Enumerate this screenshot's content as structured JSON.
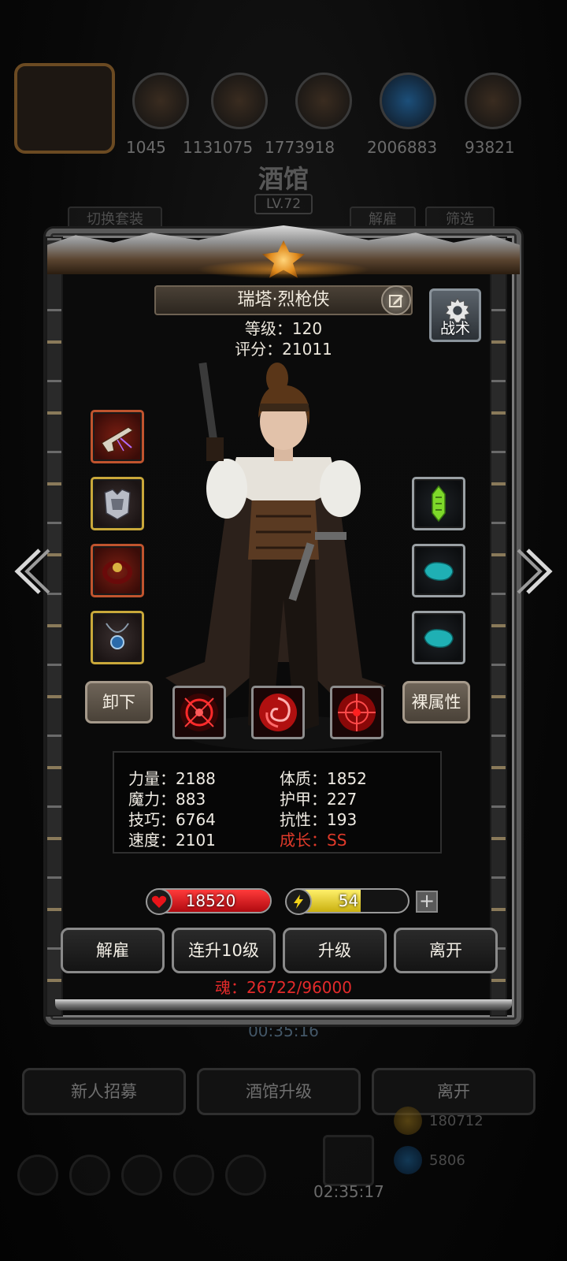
{
  "background": {
    "resource_numbers": [
      "1045",
      "1131075",
      "1773918",
      "2006883",
      "93821"
    ],
    "title": "酒馆",
    "level": "LV.72",
    "switch_outfit": "切换套装",
    "dismiss": "解雇",
    "filter": "筛选",
    "timer_mid": "00:35:16",
    "buttons": [
      "新人招募",
      "酒馆升级",
      "离开"
    ],
    "timer_bottom": "02:35:17",
    "gold": "180712",
    "gems": "5806"
  },
  "hero": {
    "name": "瑞塔·烈枪侠",
    "level_label": "等级：120",
    "score_label": "评分：21011",
    "tactics_label": "战术"
  },
  "actions": {
    "unequip": "卸下",
    "naked_attr": "裸属性"
  },
  "stats": [
    {
      "label": "力量：2188"
    },
    {
      "label": "体质：1852"
    },
    {
      "label": "魔力：883"
    },
    {
      "label": "护甲：227"
    },
    {
      "label": "技巧：6764"
    },
    {
      "label": "抗性：193"
    },
    {
      "label": "速度：2101"
    },
    {
      "label": "成长：SS"
    }
  ],
  "hp": {
    "value": "18520",
    "fill": 1.0
  },
  "energy": {
    "value": "54",
    "fill": 0.6
  },
  "panel_buttons": {
    "dismiss": "解雇",
    "level_up_10": "连升10级",
    "level_up": "升级",
    "leave": "离开"
  },
  "soul": "魂：26722/96000",
  "colors": {
    "hp": "#d8141a",
    "energy": "#e8d21a",
    "growth": "#e03a2a",
    "soul": "#e42a2a"
  }
}
